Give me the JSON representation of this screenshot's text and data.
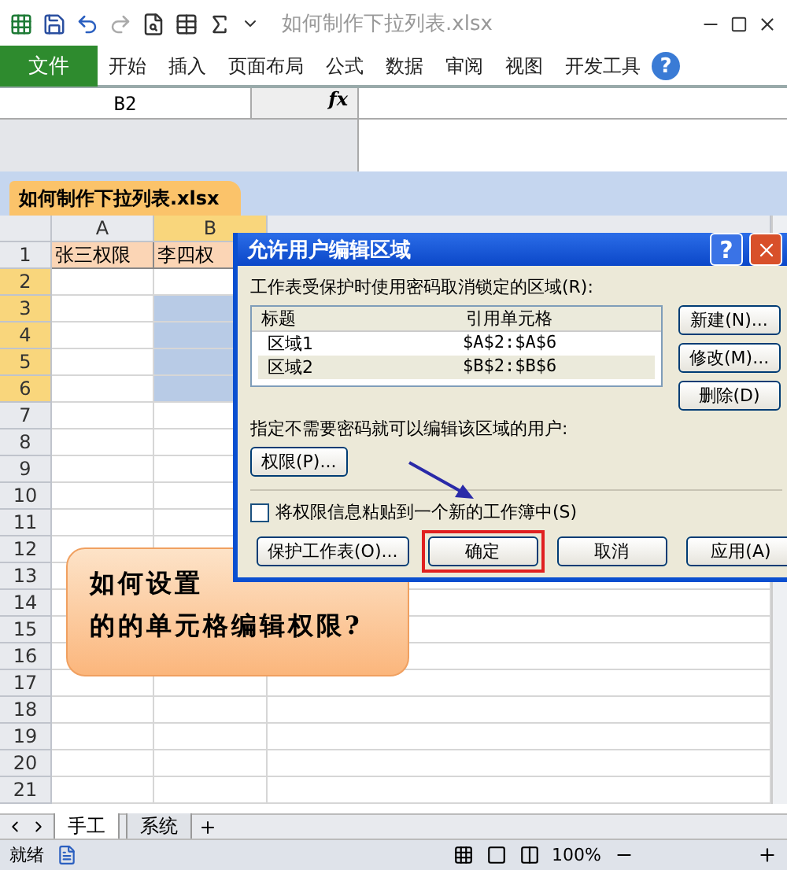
{
  "title_bar": {
    "title": "如何制作下拉列表.xlsx"
  },
  "ribbon": {
    "file_tab": "文件",
    "tabs": [
      "开始",
      "插入",
      "页面布局",
      "公式",
      "数据",
      "审阅",
      "视图",
      "开发工具"
    ],
    "help": "?"
  },
  "formula_bar": {
    "name_box": "B2",
    "fx_label": "fx"
  },
  "workbook_tab": "如何制作下拉列表.xlsx",
  "columns": [
    {
      "label": "A",
      "selected": false
    },
    {
      "label": "B",
      "selected": true
    }
  ],
  "rows": [
    {
      "number": "1",
      "selected": false,
      "cells": [
        {
          "text": "张三权限",
          "selected": false
        },
        {
          "text": "李四权",
          "selected": false
        }
      ]
    },
    {
      "number": "2",
      "selected": true,
      "cells": [
        {
          "text": "",
          "selected": false
        },
        {
          "text": "",
          "selected": false
        }
      ]
    },
    {
      "number": "3",
      "selected": true,
      "cells": [
        {
          "text": "",
          "selected": false
        },
        {
          "text": "",
          "selected": true
        }
      ]
    },
    {
      "number": "4",
      "selected": true,
      "cells": [
        {
          "text": "",
          "selected": false
        },
        {
          "text": "",
          "selected": true
        }
      ]
    },
    {
      "number": "5",
      "selected": true,
      "cells": [
        {
          "text": "",
          "selected": false
        },
        {
          "text": "",
          "selected": true
        }
      ]
    },
    {
      "number": "6",
      "selected": true,
      "cells": [
        {
          "text": "",
          "selected": false
        },
        {
          "text": "",
          "selected": true
        }
      ]
    },
    {
      "number": "7",
      "selected": false
    },
    {
      "number": "8",
      "selected": false
    },
    {
      "number": "9",
      "selected": false
    },
    {
      "number": "10",
      "selected": false
    },
    {
      "number": "11",
      "selected": false
    },
    {
      "number": "12",
      "selected": false
    },
    {
      "number": "13",
      "selected": false
    },
    {
      "number": "14",
      "selected": false
    },
    {
      "number": "15",
      "selected": false
    },
    {
      "number": "16",
      "selected": false
    },
    {
      "number": "17",
      "selected": false
    },
    {
      "number": "18",
      "selected": false
    },
    {
      "number": "19",
      "selected": false
    },
    {
      "number": "20",
      "selected": false
    },
    {
      "number": "21",
      "selected": false
    }
  ],
  "callout": {
    "lines": [
      "如何设置",
      "的的单元格编辑权限?"
    ]
  },
  "dialog": {
    "title": "允许用户编辑区域",
    "help": "?",
    "ranges_label": "工作表受保护时使用密码取消锁定的区域(R):",
    "list_columns": [
      "标题",
      "引用单元格"
    ],
    "ranges": [
      {
        "title": "区域1",
        "ref": "$A$2:$A$6",
        "selected": false
      },
      {
        "title": "区域2",
        "ref": "$B$2:$B$6",
        "selected": true
      }
    ],
    "side_buttons": [
      "新建(N)...",
      "修改(M)...",
      "删除(D)"
    ],
    "users_label": "指定不需要密码就可以编辑该区域的用户:",
    "permissions_button": "权限(P)...",
    "paste_checkbox": {
      "label": "将权限信息粘贴到一个新的工作簿中(S)",
      "checked": false
    },
    "bottom_buttons": [
      {
        "label": "保护工作表(O)...",
        "highlighted": false
      },
      {
        "label": "确定",
        "highlighted": true
      },
      {
        "label": "取消",
        "highlighted": false
      },
      {
        "label": "应用(A)",
        "highlighted": false
      }
    ]
  },
  "sheet_tabs": [
    {
      "label": "手工",
      "selected": true
    },
    {
      "label": "系统",
      "selected": false
    }
  ],
  "status_bar": {
    "status": "就绪",
    "zoom": "100%"
  }
}
